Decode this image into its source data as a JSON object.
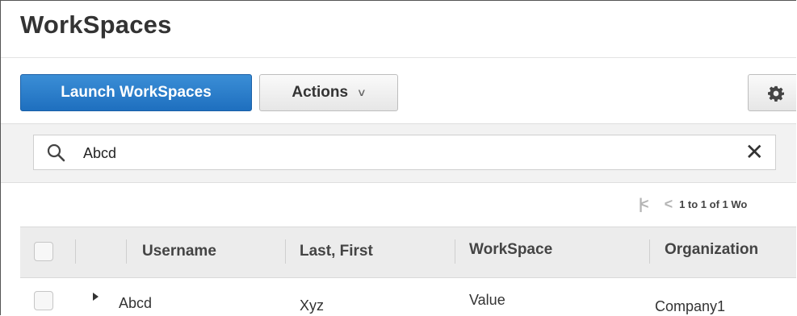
{
  "page": {
    "title": "WorkSpaces"
  },
  "toolbar": {
    "launch_label": "Launch WorkSpaces",
    "actions_label": "Actions",
    "actions_chevron": "∨",
    "settings_icon": "gear-icon"
  },
  "search": {
    "value": "Abcd",
    "icon": "search-icon",
    "clear_glyph": "✕"
  },
  "pagination": {
    "info": "1 to 1 of 1 Wo",
    "first_glyph": "|<",
    "prev_glyph": "<"
  },
  "table": {
    "columns": [
      "Username",
      "Last, First",
      "WorkSpace",
      "Organization"
    ],
    "rows": [
      {
        "username": "Abcd",
        "last_first": "Xyz",
        "workspace": "Value",
        "organization": "Company1"
      }
    ]
  },
  "colors": {
    "primary": "#1e6fbf",
    "header_bg": "#ececec",
    "filter_bg": "#f2f2f2"
  }
}
